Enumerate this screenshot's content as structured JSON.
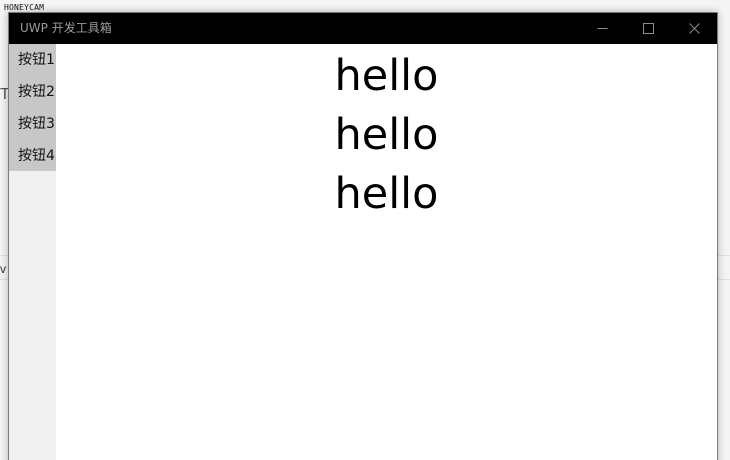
{
  "watermark": "HONEYCAM",
  "background_fragments": {
    "left_text": "T",
    "left_text_2": "v"
  },
  "window": {
    "title": "UWP 开发工具箱",
    "controls": {
      "minimize_icon": "minimize-icon",
      "maximize_icon": "maximize-icon",
      "close_icon": "close-icon"
    }
  },
  "sidebar": {
    "items": [
      {
        "label": "按钮1"
      },
      {
        "label": "按钮2"
      },
      {
        "label": "按钮3"
      },
      {
        "label": "按钮4"
      }
    ]
  },
  "main": {
    "messages": [
      "hello",
      "hello",
      "hello"
    ]
  },
  "colors": {
    "titlebar": "#000000",
    "sidebar_selected_area": "#c7c7c7",
    "sidebar_bg": "#f0f0f0",
    "content_bg": "#ffffff"
  }
}
